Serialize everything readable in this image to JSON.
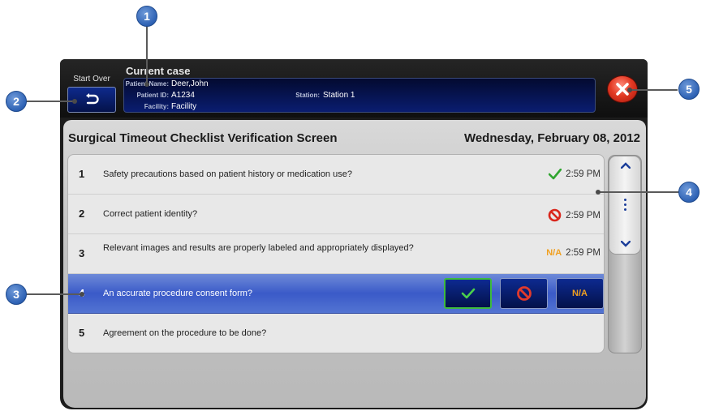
{
  "header": {
    "start_over_label": "Start Over",
    "current_case_title": "Current case",
    "patient_name_label": "Patient Name:",
    "patient_name": "Deer,John",
    "patient_id_label": "Patient ID:",
    "patient_id": "A1234",
    "facility_label": "Facility:",
    "facility": "Facility",
    "station_label": "Station:",
    "station": "Station 1"
  },
  "screen": {
    "title": "Surgical Timeout Checklist Verification Screen",
    "date": "Wednesday, February 08, 2012"
  },
  "checklist": [
    {
      "num": "1",
      "text": "Safety precautions based on patient history or medication use?",
      "status": "check",
      "time": "2:59 PM"
    },
    {
      "num": "2",
      "text": "Correct patient identity?",
      "status": "no",
      "time": "2:59 PM"
    },
    {
      "num": "3",
      "text": "Relevant images and results are properly labeled and appropriately displayed?",
      "status": "na",
      "na_label": "N/A",
      "time": "2:59 PM"
    },
    {
      "num": "4",
      "text": "An accurate procedure consent form?",
      "status": "selected"
    },
    {
      "num": "5",
      "text": "Agreement on the procedure to be done?",
      "status": "none"
    }
  ],
  "action_buttons": {
    "na_label": "N/A"
  },
  "callouts": [
    "1",
    "2",
    "3",
    "4",
    "5"
  ],
  "colors": {
    "accent_blue": "#2e62b4",
    "check_green": "#3dbb3d",
    "na_orange": "#f0a020",
    "close_red": "#e33a24"
  }
}
